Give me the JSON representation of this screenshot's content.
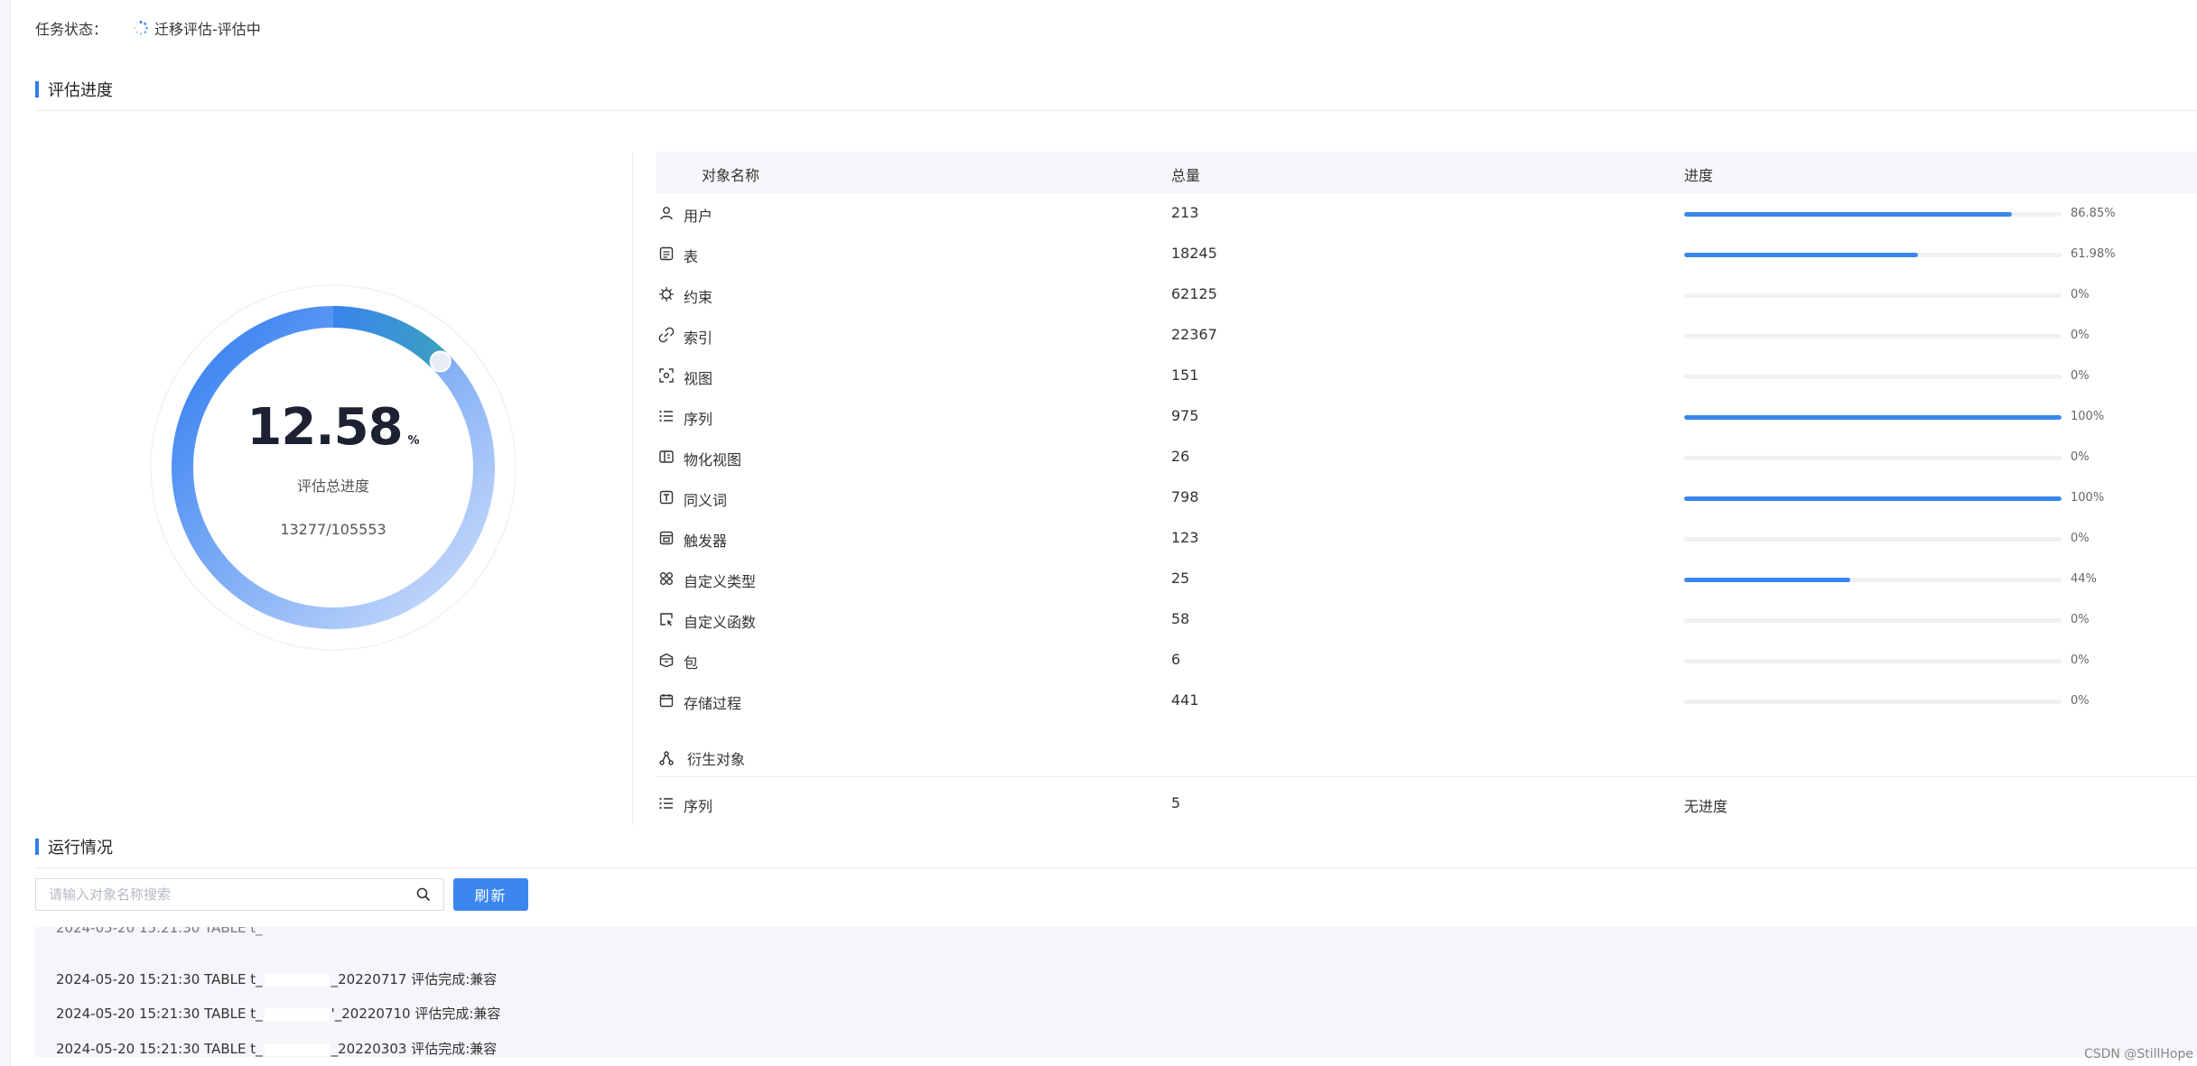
{
  "status": {
    "label": "任务状态：",
    "value": "迁移评估-评估中"
  },
  "eval_section": {
    "title": "评估进度"
  },
  "gauge": {
    "value": "12.58",
    "unit": "%",
    "label": "评估总进度",
    "count": "13277/105553",
    "progress": 0.1258
  },
  "table": {
    "headers": {
      "name": "对象名称",
      "total": "总量",
      "progress": "进度"
    },
    "rows": [
      {
        "icon": "user-icon",
        "name": "用户",
        "total": "213",
        "pct": "86.85%",
        "progress": 0.8685
      },
      {
        "icon": "table-icon",
        "name": "表",
        "total": "18245",
        "pct": "61.98%",
        "progress": 0.6198
      },
      {
        "icon": "constraint-icon",
        "name": "约束",
        "total": "62125",
        "pct": "0%",
        "progress": 0
      },
      {
        "icon": "index-icon",
        "name": "索引",
        "total": "22367",
        "pct": "0%",
        "progress": 0
      },
      {
        "icon": "view-icon",
        "name": "视图",
        "total": "151",
        "pct": "0%",
        "progress": 0
      },
      {
        "icon": "sequence-icon",
        "name": "序列",
        "total": "975",
        "pct": "100%",
        "progress": 1
      },
      {
        "icon": "materialized-view-icon",
        "name": "物化视图",
        "total": "26",
        "pct": "0%",
        "progress": 0
      },
      {
        "icon": "synonym-icon",
        "name": "同义词",
        "total": "798",
        "pct": "100%",
        "progress": 1
      },
      {
        "icon": "trigger-icon",
        "name": "触发器",
        "total": "123",
        "pct": "0%",
        "progress": 0
      },
      {
        "icon": "custom-type-icon",
        "name": "自定义类型",
        "total": "25",
        "pct": "44%",
        "progress": 0.44
      },
      {
        "icon": "custom-function-icon",
        "name": "自定义函数",
        "total": "58",
        "pct": "0%",
        "progress": 0
      },
      {
        "icon": "package-icon",
        "name": "包",
        "total": "6",
        "pct": "0%",
        "progress": 0
      },
      {
        "icon": "procedure-icon",
        "name": "存储过程",
        "total": "441",
        "pct": "0%",
        "progress": 0
      }
    ]
  },
  "derived": {
    "title": "衍生对象",
    "rows": [
      {
        "icon": "sequence-icon",
        "name": "序列",
        "total": "5",
        "progress_text": "无进度"
      }
    ]
  },
  "run_section": {
    "title": "运行情况"
  },
  "search": {
    "placeholder": "请输入对象名称搜索",
    "value": ""
  },
  "refresh_label": "刷新",
  "logs": [
    {
      "pre": "2024-05-20 15:21:30 TABLE t_",
      "post": "_20220717 评估完成:兼容"
    },
    {
      "pre": "2024-05-20 15:21:30 TABLE t_",
      "post": "'_20220710 评估完成:兼容"
    },
    {
      "pre": "2024-05-20 15:21:30 TABLE t_",
      "post": "_20220303 评估完成:兼容"
    }
  ],
  "watermark": "CSDN @StillHope",
  "colors": {
    "accent": "#3b86ee",
    "track": "#f0f1f4",
    "header_bg": "#f6f7fa",
    "log_bg": "#f4f6fa"
  }
}
